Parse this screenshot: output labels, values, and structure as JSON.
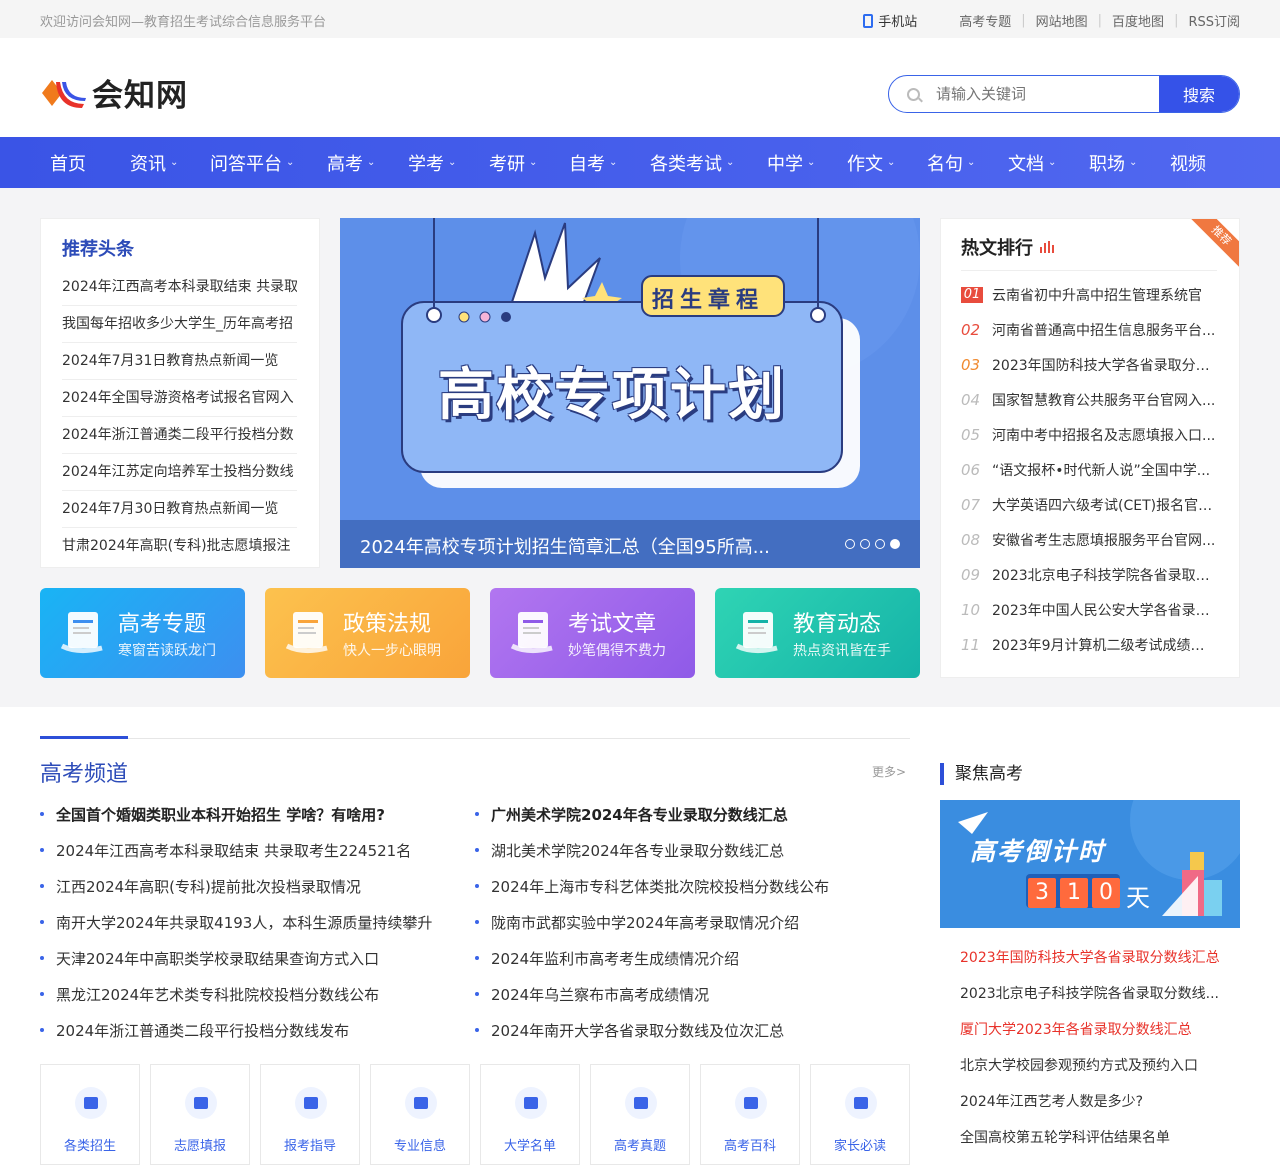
{
  "topbar": {
    "welcome": "欢迎访问会知网—教育招生考试综合信息服务平台",
    "mobile": "手机站",
    "links": [
      "高考专题",
      "网站地图",
      "百度地图",
      "RSS订阅"
    ]
  },
  "logo": {
    "text": "会知网"
  },
  "search": {
    "placeholder": "请输入关键词",
    "button": "搜索"
  },
  "nav": [
    {
      "label": "首页",
      "dropdown": false
    },
    {
      "label": "资讯",
      "dropdown": true
    },
    {
      "label": "问答平台",
      "dropdown": true
    },
    {
      "label": "高考",
      "dropdown": true
    },
    {
      "label": "学考",
      "dropdown": true
    },
    {
      "label": "考研",
      "dropdown": true
    },
    {
      "label": "自考",
      "dropdown": true
    },
    {
      "label": "各类考试",
      "dropdown": true
    },
    {
      "label": "中学",
      "dropdown": true
    },
    {
      "label": "作文",
      "dropdown": true
    },
    {
      "label": "名句",
      "dropdown": true
    },
    {
      "label": "文档",
      "dropdown": true
    },
    {
      "label": "职场",
      "dropdown": true
    },
    {
      "label": "视频",
      "dropdown": false
    }
  ],
  "recommend": {
    "title": "推荐头条",
    "items": [
      "2024年江西高考本科录取结束 共录取",
      "我国每年招收多少大学生_历年高考招",
      "2024年7月31日教育热点新闻一览",
      "2024年全国导游资格考试报名官网入",
      "2024年浙江普通类二段平行投档分数",
      "2024年江苏定向培养军士投档分数线",
      "2024年7月30日教育热点新闻一览",
      "甘肃2024年高职(专科)批志愿填报注"
    ]
  },
  "banner": {
    "caption": "2024年高校专项计划招生简章汇总（全国95所高...",
    "headline": "高校专项计划",
    "badge": "招生章程",
    "slides": 4,
    "active_slide": 4
  },
  "cards": [
    {
      "title": "高考专题",
      "sub": "寒窗苦读跃龙门",
      "icon": "certificate-hand-icon",
      "bg": "#23a8f0"
    },
    {
      "title": "政策法规",
      "sub": "快人一步心眼明",
      "icon": "document-pen-icon",
      "bg": "#fbb23f"
    },
    {
      "title": "考试文章",
      "sub": "妙笔偶得不费力",
      "icon": "book-w-icon",
      "bg": "#a768ee"
    },
    {
      "title": "教育动态",
      "sub": "热点资讯皆在手",
      "icon": "newspaper-icon",
      "bg": "#22c4ae"
    }
  ],
  "hot": {
    "title": "热文排行",
    "tag": "推荐",
    "items": [
      {
        "n": "01",
        "t": "云南省初中升高中招生管理系统官"
      },
      {
        "n": "02",
        "t": "河南省普通高中招生信息服务平台..."
      },
      {
        "n": "03",
        "t": "2023年国防科技大学各省录取分数..."
      },
      {
        "n": "04",
        "t": "国家智慧教育公共服务平台官网入..."
      },
      {
        "n": "05",
        "t": "河南中考中招报名及志愿填报入口..."
      },
      {
        "n": "06",
        "t": "“语文报杯•时代新人说”全国中学..."
      },
      {
        "n": "07",
        "t": "大学英语四六级考试(CET)报名官网..."
      },
      {
        "n": "08",
        "t": "安徽省考生志愿填报服务平台官网..."
      },
      {
        "n": "09",
        "t": "2023北京电子科技学院各省录取分..."
      },
      {
        "n": "10",
        "t": "2023年中国人民公安大学各省录取..."
      },
      {
        "n": "11",
        "t": "2023年9月计算机二级考试成绩查..."
      }
    ]
  },
  "gaokao": {
    "title": "高考频道",
    "more": "更多>",
    "left": [
      {
        "t": "全国首个婚姻类职业本科开始招生 学啥？有啥用?",
        "bold": true
      },
      {
        "t": "2024年江西高考本科录取结束 共录取考生224521名"
      },
      {
        "t": "江西2024年高职(专科)提前批次投档录取情况"
      },
      {
        "t": "南开大学2024年共录取4193人，本科生源质量持续攀升"
      },
      {
        "t": "天津2024年中高职类学校录取结果查询方式入口"
      },
      {
        "t": "黑龙江2024年艺术类专科批院校投档分数线公布"
      },
      {
        "t": "2024年浙江普通类二段平行投档分数线发布"
      }
    ],
    "right": [
      {
        "t": "广州美术学院2024年各专业录取分数线汇总",
        "bold": true
      },
      {
        "t": "湖北美术学院2024年各专业录取分数线汇总"
      },
      {
        "t": "2024年上海市专科艺体类批次院校投档分数线公布"
      },
      {
        "t": "陇南市武都实验中学2024年高考录取情况介绍"
      },
      {
        "t": "2024年监利市高考考生成绩情况介绍"
      },
      {
        "t": "2024年乌兰察布市高考成绩情况"
      },
      {
        "t": "2024年南开大学各省录取分数线及位次汇总"
      }
    ],
    "quick": [
      "各类招生",
      "志愿填报",
      "报考指导",
      "专业信息",
      "大学名单",
      "高考真题",
      "高考百科",
      "家长必读"
    ]
  },
  "focus": {
    "title": "聚焦高考",
    "img_title": "高考倒计时",
    "countdown": [
      "3",
      "1",
      "0"
    ],
    "unit": "天",
    "items": [
      {
        "t": "2023年国防科技大学各省录取分数线汇总",
        "red": true
      },
      {
        "t": "2023北京电子科技学院各省录取分数线..."
      },
      {
        "t": "厦门大学2023年各省录取分数线汇总",
        "red": true
      },
      {
        "t": "北京大学校园参观预约方式及预约入口"
      },
      {
        "t": "2024年江西艺考人数是多少?"
      },
      {
        "t": "全国高校第五轮学科评估结果名单"
      }
    ]
  },
  "colors": {
    "primary": "#2d4fd8",
    "nav_bg": "#3a54e6",
    "hot_red": "#e84c3d"
  }
}
